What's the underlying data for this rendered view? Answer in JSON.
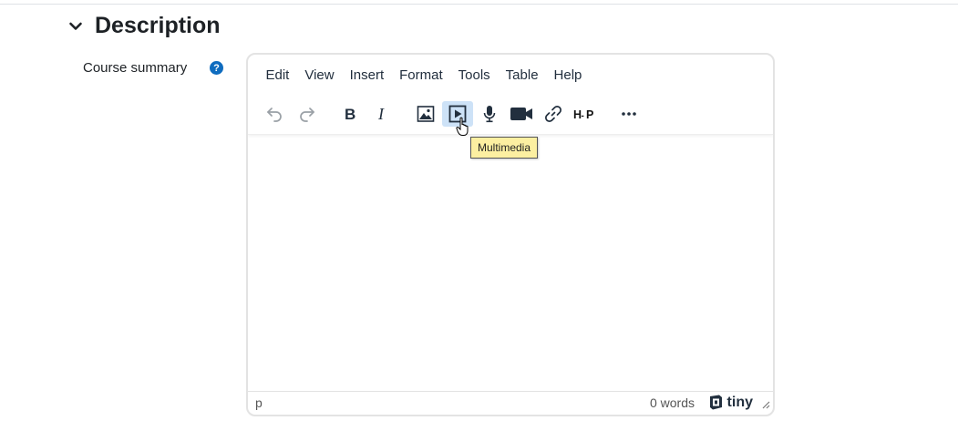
{
  "section": {
    "title": "Description",
    "toggle_icon": "chevron-down-icon"
  },
  "field": {
    "label": "Course summary",
    "help_glyph": "?",
    "help_color": "#0f6cbf"
  },
  "editor": {
    "menu": [
      "Edit",
      "View",
      "Insert",
      "Format",
      "Tools",
      "Table",
      "Help"
    ],
    "toolbar": [
      {
        "name": "undo",
        "icon": "undo-icon",
        "state": "disabled"
      },
      {
        "name": "redo",
        "icon": "redo-icon",
        "state": "disabled"
      },
      {
        "name": "bold",
        "icon": "bold-icon"
      },
      {
        "name": "italic",
        "icon": "italic-icon"
      },
      {
        "name": "image",
        "icon": "image-icon"
      },
      {
        "name": "multimedia",
        "icon": "multimedia-icon",
        "state": "hovered"
      },
      {
        "name": "record-audio",
        "icon": "microphone-icon"
      },
      {
        "name": "record-video",
        "icon": "video-camera-icon"
      },
      {
        "name": "link",
        "icon": "link-icon"
      },
      {
        "name": "h5p",
        "icon": "h5p-icon"
      },
      {
        "name": "more",
        "icon": "more-horizontal-icon"
      }
    ],
    "tooltip": "Multimedia",
    "status": {
      "path": "p",
      "word_count": "0 words",
      "brand": "tiny"
    },
    "hover_color": "#cde2f7"
  }
}
